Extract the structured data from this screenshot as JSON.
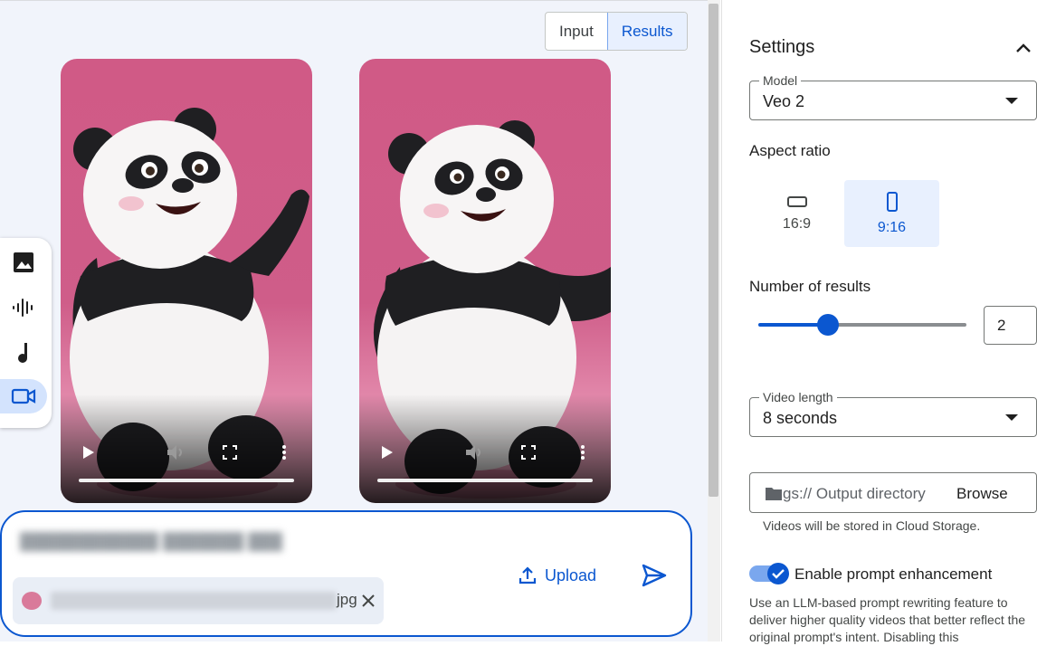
{
  "tabs": [
    {
      "label": "Input",
      "active": false
    },
    {
      "label": "Results",
      "active": true
    }
  ],
  "tool_rail": {
    "items": [
      {
        "icon": "image-icon"
      },
      {
        "icon": "audio-waveform-icon"
      },
      {
        "icon": "music-note-icon"
      },
      {
        "icon": "video-camera-icon",
        "active": true
      }
    ]
  },
  "videos": [
    {
      "controls": [
        "play-icon",
        "volume-icon",
        "fullscreen-icon",
        "more-vert-icon"
      ]
    },
    {
      "controls": [
        "play-icon",
        "volume-icon",
        "fullscreen-icon",
        "more-vert-icon"
      ]
    }
  ],
  "prompt": {
    "attachment_ext": "jpg",
    "upload_label": "Upload"
  },
  "settings": {
    "title": "Settings",
    "model": {
      "label": "Model",
      "value": "Veo 2"
    },
    "aspect": {
      "label": "Aspect ratio",
      "options": [
        {
          "label": "16:9",
          "selected": false
        },
        {
          "label": "9:16",
          "selected": true
        }
      ]
    },
    "results": {
      "label": "Number of results",
      "value": "2",
      "slider_fraction": 0.33
    },
    "length": {
      "label": "Video length",
      "value": "8 seconds"
    },
    "output": {
      "placeholder": "gs:// Output directory",
      "browse_label": "Browse",
      "hint": "Videos will be stored in Cloud Storage."
    },
    "enhance": {
      "label": "Enable prompt enhancement",
      "enabled": true,
      "description": "Use an LLM-based prompt rewriting feature to deliver higher quality videos that better reflect the original prompt's intent. Disabling this"
    }
  },
  "colors": {
    "accent": "#0b57d0",
    "selected_bg": "#e8f0fe",
    "video_bg": "#d05a86"
  }
}
